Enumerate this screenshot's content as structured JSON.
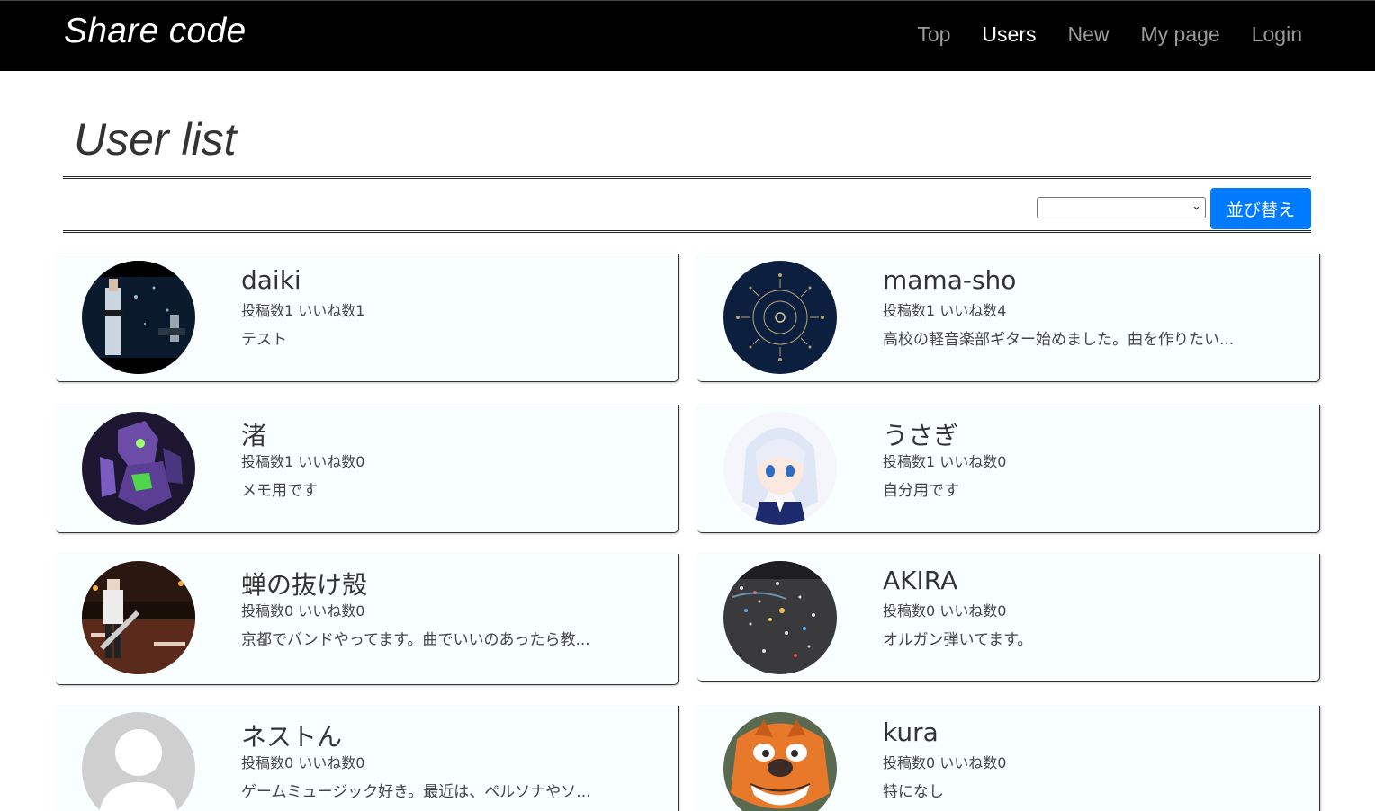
{
  "navbar": {
    "brand": "Share code",
    "links": [
      {
        "label": "Top",
        "active": false
      },
      {
        "label": "Users",
        "active": true
      },
      {
        "label": "New",
        "active": false
      },
      {
        "label": "My page",
        "active": false
      },
      {
        "label": "Login",
        "active": false
      }
    ]
  },
  "page": {
    "title": "User list",
    "sort": {
      "selected": "",
      "button_label": "並び替え"
    }
  },
  "users": [
    {
      "name": "daiki",
      "stats": "投稿数1 いいね数1",
      "bio": "テスト"
    },
    {
      "name": "mama-sho",
      "stats": "投稿数1 いいね数4",
      "bio": "高校の軽音楽部ギター始めました。曲を作りたい..."
    },
    {
      "name": "渚",
      "stats": "投稿数1 いいね数0",
      "bio": "メモ用です"
    },
    {
      "name": "うさぎ",
      "stats": "投稿数1 いいね数0",
      "bio": "自分用です"
    },
    {
      "name": "蝉の抜け殻",
      "stats": "投稿数0 いいね数0",
      "bio": "京都でバンドやってます。曲でいいのあったら教..."
    },
    {
      "name": "AKIRA",
      "stats": "投稿数0 いいね数0",
      "bio": "オルガン弾いてます。"
    },
    {
      "name": "ネストん",
      "stats": "投稿数0 いいね数0",
      "bio": "ゲームミュージック好き。最近は、ペルソナやソ..."
    },
    {
      "name": "kura",
      "stats": "投稿数0 いいね数0",
      "bio": "特になし"
    }
  ],
  "colors": {
    "navbar_bg": "#000000",
    "button_blue": "#007bff",
    "card_bg": "#f8fffe"
  }
}
